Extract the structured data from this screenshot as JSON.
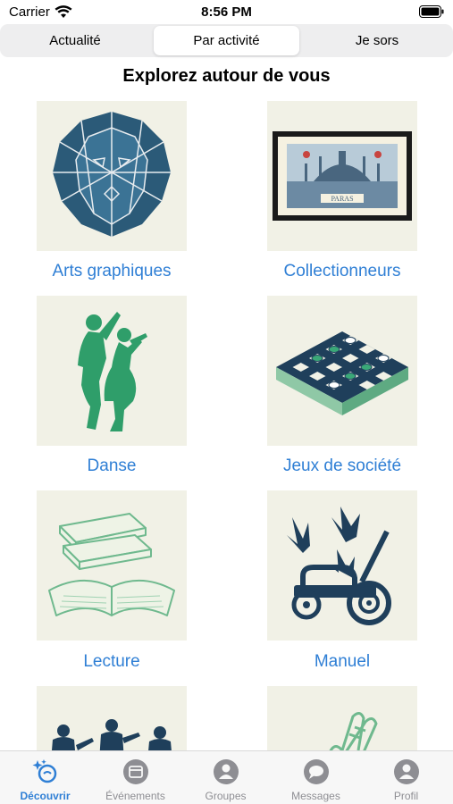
{
  "status": {
    "carrier": "Carrier",
    "time": "8:56 PM"
  },
  "segments": [
    "Actualité",
    "Par activité",
    "Je sors"
  ],
  "selected_segment": "Par activité",
  "title": "Explorez autour de vous",
  "activities": [
    {
      "label": "Arts graphiques",
      "icon": "geometric-lion-icon"
    },
    {
      "label": "Collectionneurs",
      "icon": "postage-stamp-icon"
    },
    {
      "label": "Danse",
      "icon": "dancing-couple-icon"
    },
    {
      "label": "Jeux de société",
      "icon": "checkers-board-icon"
    },
    {
      "label": "Lecture",
      "icon": "books-icon"
    },
    {
      "label": "Manuel",
      "icon": "lawn-mower-icon"
    },
    {
      "label": "",
      "icon": "musicians-icon"
    },
    {
      "label": "",
      "icon": "praying-hands-icon"
    }
  ],
  "tabs": [
    {
      "label": "Découvrir",
      "icon": "discover-icon",
      "active": true
    },
    {
      "label": "Événements",
      "icon": "calendar-icon",
      "active": false
    },
    {
      "label": "Groupes",
      "icon": "groups-icon",
      "active": false
    },
    {
      "label": "Messages",
      "icon": "messages-icon",
      "active": false
    },
    {
      "label": "Profil",
      "icon": "profile-icon",
      "active": false
    }
  ],
  "colors": {
    "accent": "#2f7fd5",
    "tile_bg": "#f1f1e6",
    "navy": "#1f3f5b",
    "green": "#2f9e6a"
  }
}
